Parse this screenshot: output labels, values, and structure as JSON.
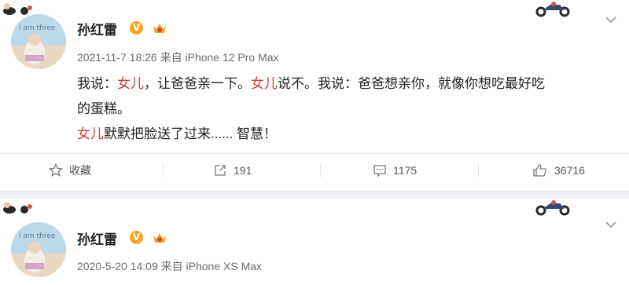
{
  "posts": [
    {
      "author": "孙红雷",
      "verified_badge": "V",
      "meta": "2021-11-7 18:26 来自 iPhone 12 Pro Max",
      "content": {
        "line1": {
          "p1": "我说：",
          "h1": "女儿",
          "p2": "，让爸爸亲一下。",
          "h2": "女儿",
          "p3": "说不。我说：爸爸想亲你，就像你想吃最好吃"
        },
        "line2": "的蛋糕。",
        "line3": {
          "h1": "女儿",
          "p1": "默默把脸送了过来...... 智慧！"
        }
      },
      "actions": {
        "favorite": "收藏",
        "repost": "191",
        "comment": "1175",
        "like": "36716"
      }
    },
    {
      "author": "孙红雷",
      "verified_badge": "V",
      "meta": "2020-5-20 14:09 来自 iPhone XS Max"
    }
  ],
  "icons": {
    "favorite": "star-icon",
    "repost": "repost-icon",
    "comment": "comment-icon",
    "like": "thumbs-up-icon",
    "chevron": "chevron-down-icon",
    "verified": "verified-v-icon",
    "member": "crown-icon"
  },
  "colors": {
    "highlight": "#c8403c",
    "verified": "#f5a623",
    "text": "#222222",
    "meta": "#6b6b6b"
  }
}
